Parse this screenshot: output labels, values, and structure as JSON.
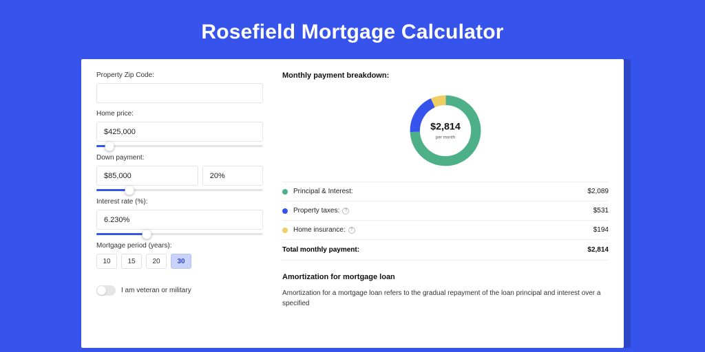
{
  "title": "Rosefield Mortgage Calculator",
  "form": {
    "zip_label": "Property Zip Code:",
    "zip_value": "",
    "price_label": "Home price:",
    "price_value": "$425,000",
    "price_slider_pct": 8,
    "down_label": "Down payment:",
    "down_value": "$85,000",
    "down_pct": "20%",
    "down_slider_pct": 20,
    "rate_label": "Interest rate (%):",
    "rate_value": "6.230%",
    "rate_slider_pct": 30,
    "period_label": "Mortgage period (years):",
    "period_options": [
      "10",
      "15",
      "20",
      "30"
    ],
    "period_selected": "30",
    "veteran_label": "I am veteran or military"
  },
  "breakdown": {
    "title": "Monthly payment breakdown:",
    "center_value": "$2,814",
    "center_sub": "per month",
    "rows": [
      {
        "color": "#4eb088",
        "label": "Principal & Interest:",
        "help": false,
        "value": "$2,089"
      },
      {
        "color": "#3653eb",
        "label": "Property taxes:",
        "help": true,
        "value": "$531"
      },
      {
        "color": "#efcf63",
        "label": "Home insurance:",
        "help": true,
        "value": "$194"
      }
    ],
    "total_label": "Total monthly payment:",
    "total_value": "$2,814"
  },
  "chart_data": {
    "type": "pie",
    "title": "Monthly payment breakdown",
    "series": [
      {
        "name": "Principal & Interest",
        "value": 2089,
        "color": "#4eb088"
      },
      {
        "name": "Property taxes",
        "value": 531,
        "color": "#3653eb"
      },
      {
        "name": "Home insurance",
        "value": 194,
        "color": "#efcf63"
      }
    ],
    "total": 2814
  },
  "amort": {
    "title": "Amortization for mortgage loan",
    "body": "Amortization for a mortgage loan refers to the gradual repayment of the loan principal and interest over a specified"
  }
}
